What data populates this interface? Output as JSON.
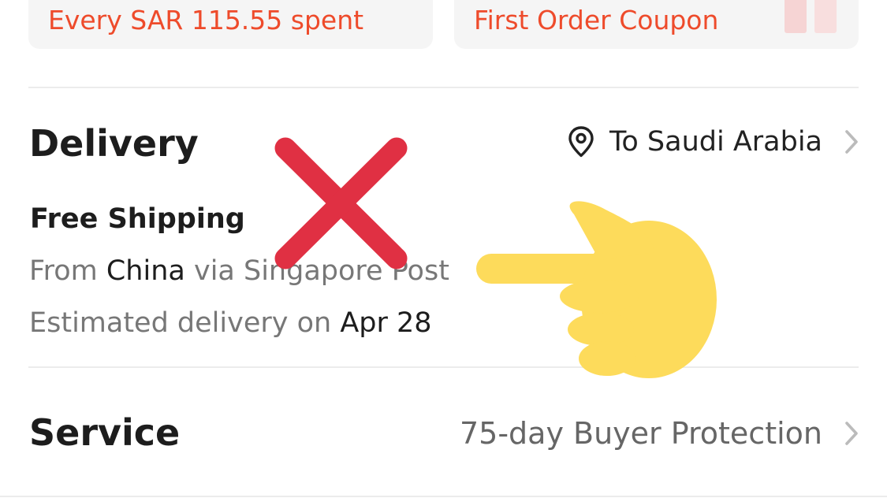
{
  "coupons": {
    "left_text": "Every SAR 115.55 spent",
    "right_text": "First Order Coupon"
  },
  "delivery": {
    "title": "Delivery",
    "destination": "To Saudi Arabia",
    "shipping_title": "Free Shipping",
    "from_prefix": "From",
    "origin": "China",
    "via_text": "via Singapore Post",
    "estimate_prefix": "Estimated delivery on",
    "estimate_date": "Apr 28"
  },
  "service": {
    "title": "Service",
    "protection": "75-day Buyer Protection"
  },
  "icons": {
    "location": "location-pin-icon",
    "chevron": "chevron-right-icon",
    "cross": "red-cross-mark-icon",
    "hand": "pointing-hand-icon"
  },
  "colors": {
    "coupon_accent": "#ee4b2b",
    "cross_red": "#e03043",
    "hand_yellow": "#fddb5b"
  }
}
